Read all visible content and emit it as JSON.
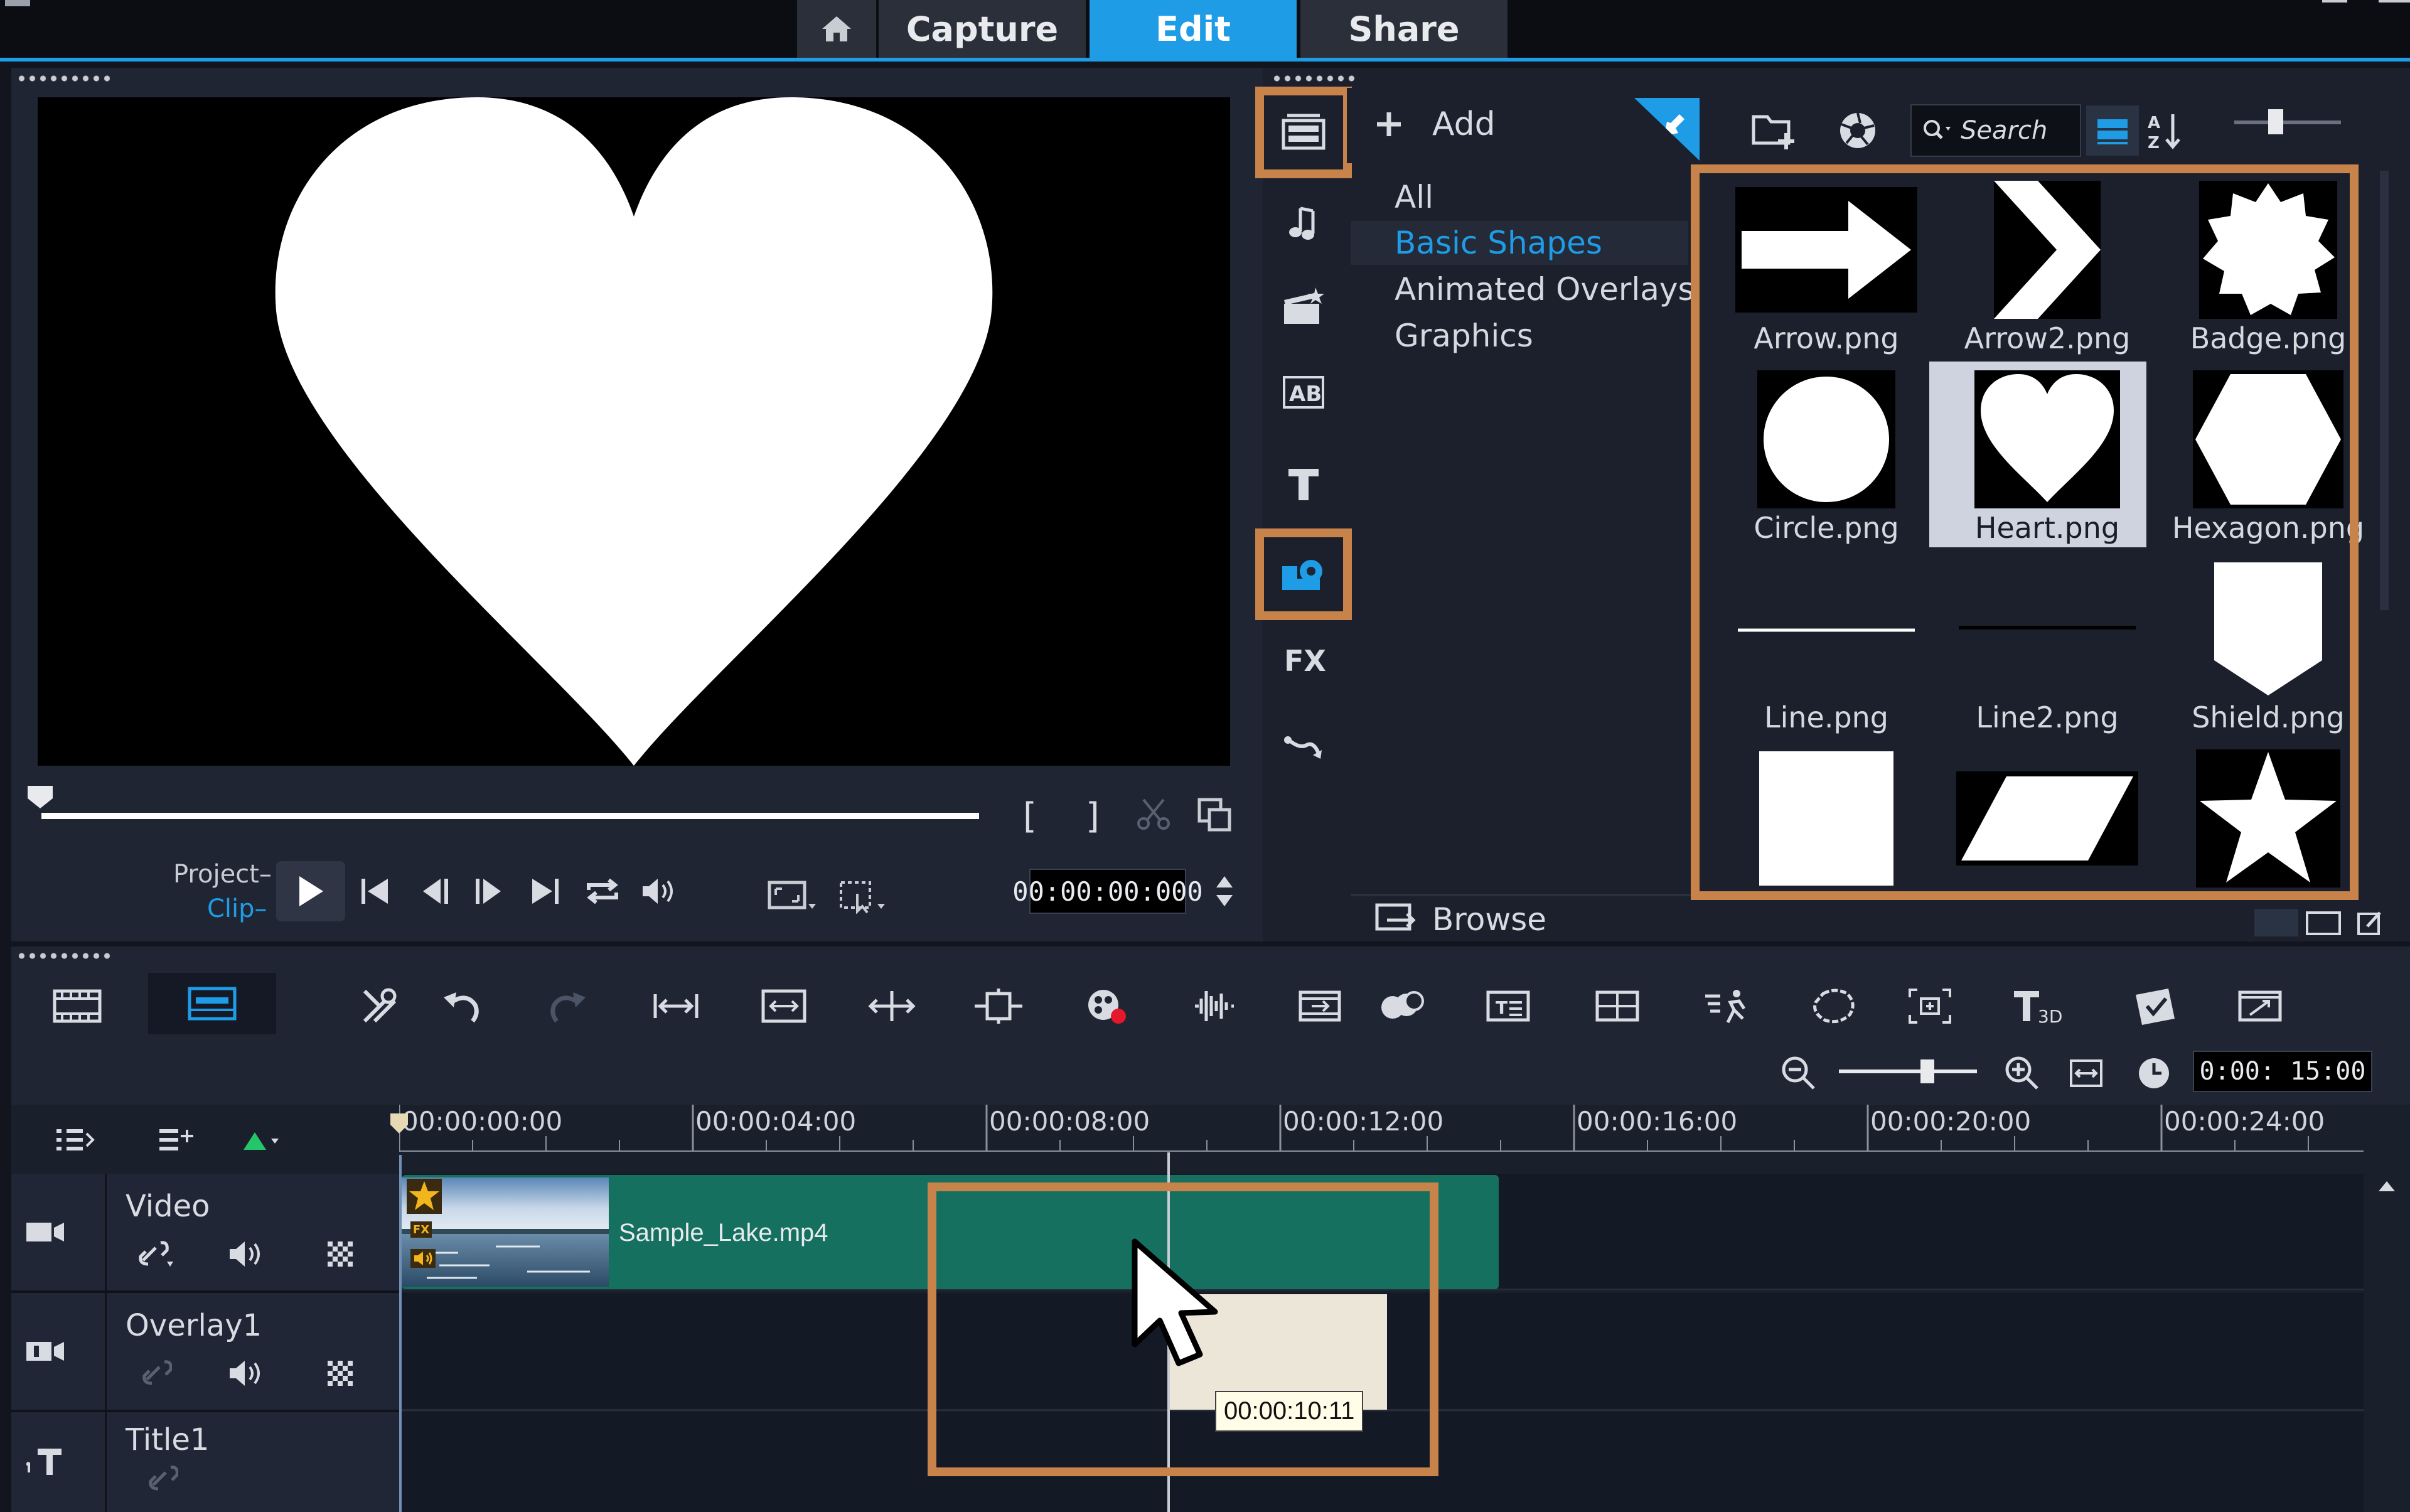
{
  "nav": {
    "capture": "Capture",
    "edit": "Edit",
    "share": "Share"
  },
  "library": {
    "add_label": "Add",
    "browse_label": "Browse",
    "search_placeholder": "Search",
    "categories": [
      "All",
      "Basic Shapes",
      "Animated Overlays",
      "Graphics"
    ],
    "selected_category": "Basic Shapes",
    "items": [
      "Arrow.png",
      "Arrow2.png",
      "Badge.png",
      "Circle.png",
      "Heart.png",
      "Hexagon.png",
      "Line.png",
      "Line2.png",
      "Shield.png",
      "",
      "",
      ""
    ],
    "selected_item": "Heart.png"
  },
  "player": {
    "mode_project": "Project",
    "mode_clip": "Clip",
    "timecode": "00:00:00:000"
  },
  "timeline": {
    "zoom_timecode": "0:00: 15:00",
    "ruler": [
      "00:00:00:00",
      "00:00:04:00",
      "00:00:08:00",
      "00:00:12:00",
      "00:00:16:00",
      "00:00:20:00",
      "00:00:24:00"
    ],
    "tracks": [
      {
        "name": "Video"
      },
      {
        "name": "Overlay1"
      },
      {
        "name": "Title1"
      }
    ],
    "clip_name": "Sample_Lake.mp4",
    "drag_tooltip": "00:00:10:11"
  },
  "colors": {
    "accent": "#1e9ce6",
    "highlight": "#c8834a",
    "clip": "#157060"
  }
}
